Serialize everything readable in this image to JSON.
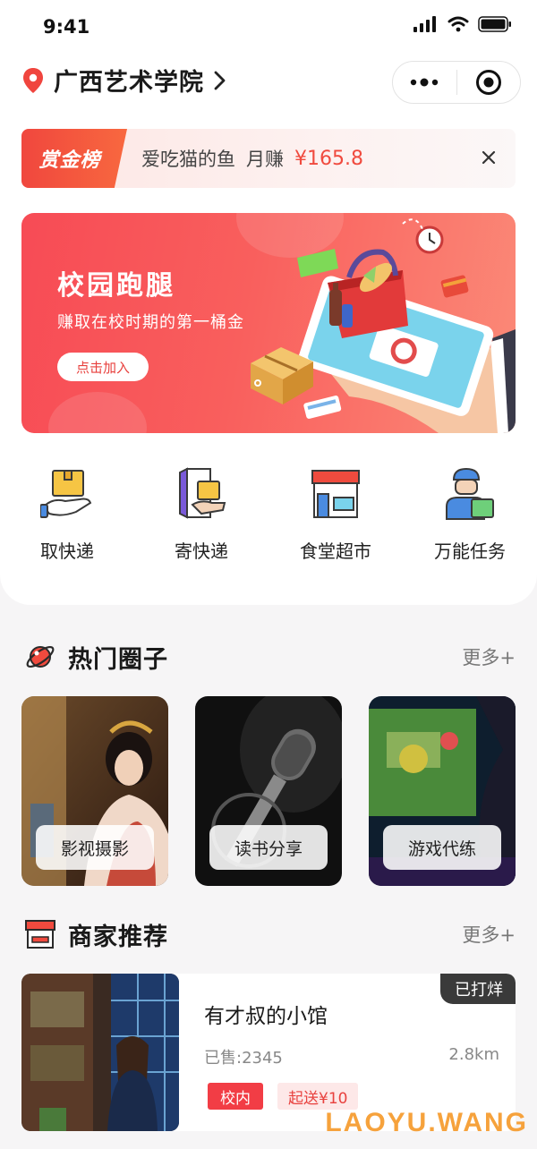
{
  "status_bar": {
    "time": "9:41",
    "icons": [
      "signal-icon",
      "wifi-icon",
      "battery-icon"
    ]
  },
  "location": {
    "name": "广西艺术学院",
    "icon": "location-pin-icon"
  },
  "capsule": {
    "icons": [
      "more-dots-icon",
      "close-mini-program-icon"
    ]
  },
  "bounty": {
    "tag": "赏金榜",
    "user": "爱吃猫的鱼",
    "label": "月赚",
    "amount": "¥165.8"
  },
  "banner": {
    "title": "校园跑腿",
    "subtitle": "赚取在校时期的第一桶金",
    "button": "点击加入"
  },
  "services": [
    {
      "label": "取快递",
      "icon": "pickup-package-icon"
    },
    {
      "label": "寄快递",
      "icon": "send-package-icon"
    },
    {
      "label": "食堂超市",
      "icon": "store-icon"
    },
    {
      "label": "万能任务",
      "icon": "courier-icon"
    }
  ],
  "hot_circles": {
    "title": "热门圈子",
    "more": "更多+",
    "items": [
      {
        "label": "影视摄影"
      },
      {
        "label": "读书分享"
      },
      {
        "label": "游戏代练"
      }
    ]
  },
  "merchants": {
    "title": "商家推荐",
    "more": "更多+",
    "items": [
      {
        "name": "有才叔的小馆",
        "sold": "已售:2345",
        "distance": "2.8km",
        "tags": [
          "校内",
          "起送¥10"
        ],
        "status": "已打烊"
      }
    ]
  },
  "watermark": "LAOYU.WANG",
  "colors": {
    "accent": "#f23d45",
    "banner_start": "#f74b55",
    "banner_end": "#fb8a78",
    "watermark": "#f6a23c"
  }
}
